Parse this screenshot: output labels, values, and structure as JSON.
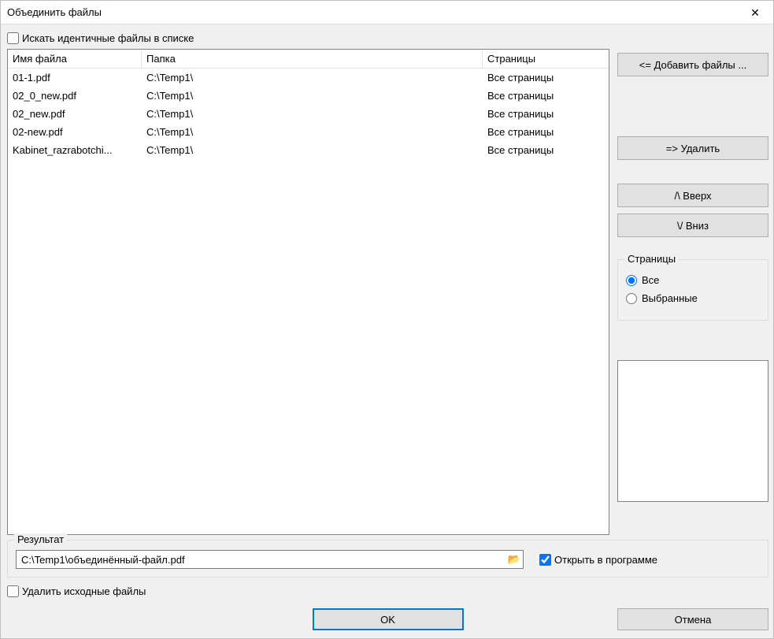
{
  "window": {
    "title": "Объединить файлы"
  },
  "top_checkbox": {
    "label": "Искать идентичные файлы в списке",
    "checked": false
  },
  "filelist": {
    "headers": {
      "name": "Имя файла",
      "folder": "Папка",
      "pages": "Страницы"
    },
    "rows": [
      {
        "name": "01-1.pdf",
        "folder": "C:\\Temp1\\",
        "pages": "Все страницы"
      },
      {
        "name": "02_0_new.pdf",
        "folder": "C:\\Temp1\\",
        "pages": "Все страницы"
      },
      {
        "name": "02_new.pdf",
        "folder": "C:\\Temp1\\",
        "pages": "Все страницы"
      },
      {
        "name": "02-new.pdf",
        "folder": "C:\\Temp1\\",
        "pages": "Все страницы"
      },
      {
        "name": "Kabinet_razrabotchi...",
        "folder": "C:\\Temp1\\",
        "pages": "Все страницы"
      }
    ]
  },
  "buttons": {
    "add_files": "<= Добавить файлы ...",
    "remove": "=> Удалить",
    "up": "/\\  Вверх",
    "down": "\\/  Вниз",
    "ok": "OK",
    "cancel": "Отмена"
  },
  "pages_group": {
    "legend": "Страницы",
    "all": "Все",
    "selected_label": "Выбранные",
    "selected": "all"
  },
  "result_group": {
    "legend": "Результат",
    "path": "C:\\Temp1\\объединённый-файл.pdf",
    "open_label": "Открыть в программе",
    "open_checked": true
  },
  "delete_src": {
    "label": "Удалить исходные файлы",
    "checked": false
  }
}
